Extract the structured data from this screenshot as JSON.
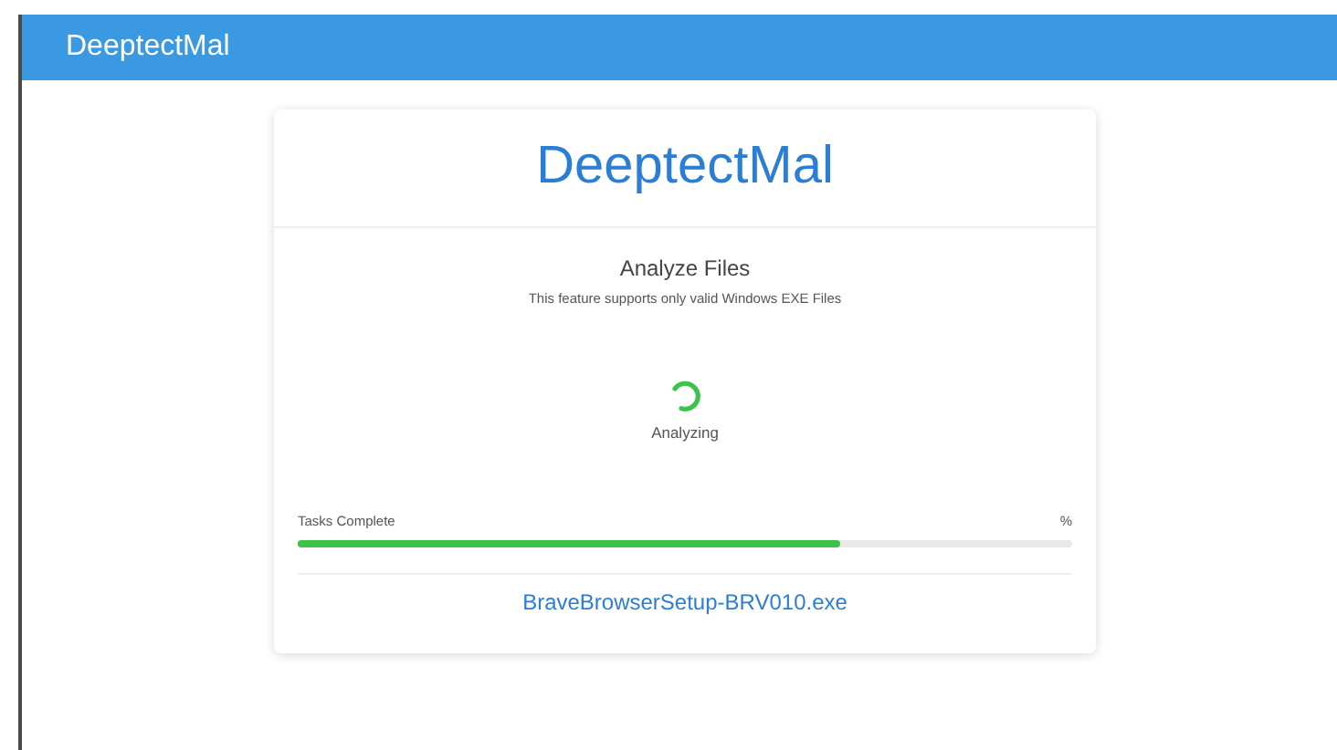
{
  "header": {
    "title": "DeeptectMal"
  },
  "card": {
    "title": "DeeptectMal",
    "heading": "Analyze Files",
    "subtitle": "This feature supports only valid Windows EXE Files",
    "status": "Analyzing",
    "progress": {
      "label": "Tasks Complete",
      "reading": "%",
      "level": 0.7
    },
    "file_name": "BraveBrowserSetup-BRV010.exe"
  }
}
